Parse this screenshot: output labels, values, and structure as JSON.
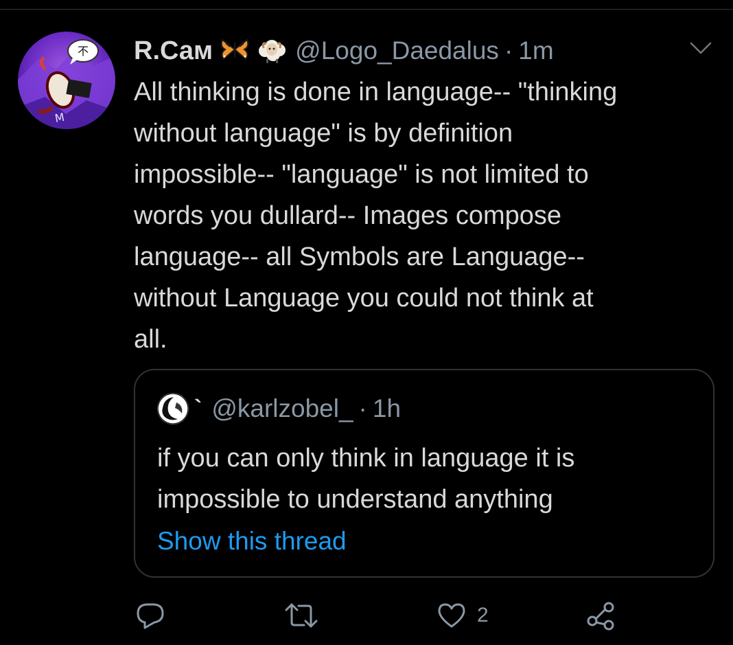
{
  "tweet": {
    "display_name": "R.Сам",
    "emoji": [
      "butterfly",
      "sheep"
    ],
    "handle": "@Logo_Daedalus",
    "separator": "·",
    "time": "1m",
    "text": "All thinking is done in language-- \"thinking\nwithout language\" is by definition\nimpossible-- \"language\" is not limited to\nwords you dullard-- Images compose\nlanguage-- all Symbols are Language--\nwithout Language you could not think at\nall."
  },
  "quoted_tweet": {
    "display_name": "`",
    "handle": "@karlzobel_",
    "separator": "·",
    "time": "1h",
    "text": "if you can only think in language it is\nimpossible to understand anything",
    "show_thread_label": "Show this thread"
  },
  "actions": {
    "reply_icon": "reply-icon",
    "retweet_icon": "retweet-icon",
    "like_icon": "heart-icon",
    "like_count": "2",
    "share_icon": "share-icon"
  },
  "colors": {
    "background": "#000000",
    "primary_text": "#d9d9d9",
    "secondary_text": "#8b98a5",
    "link": "#1d9bf0",
    "border": "#2f3336"
  }
}
